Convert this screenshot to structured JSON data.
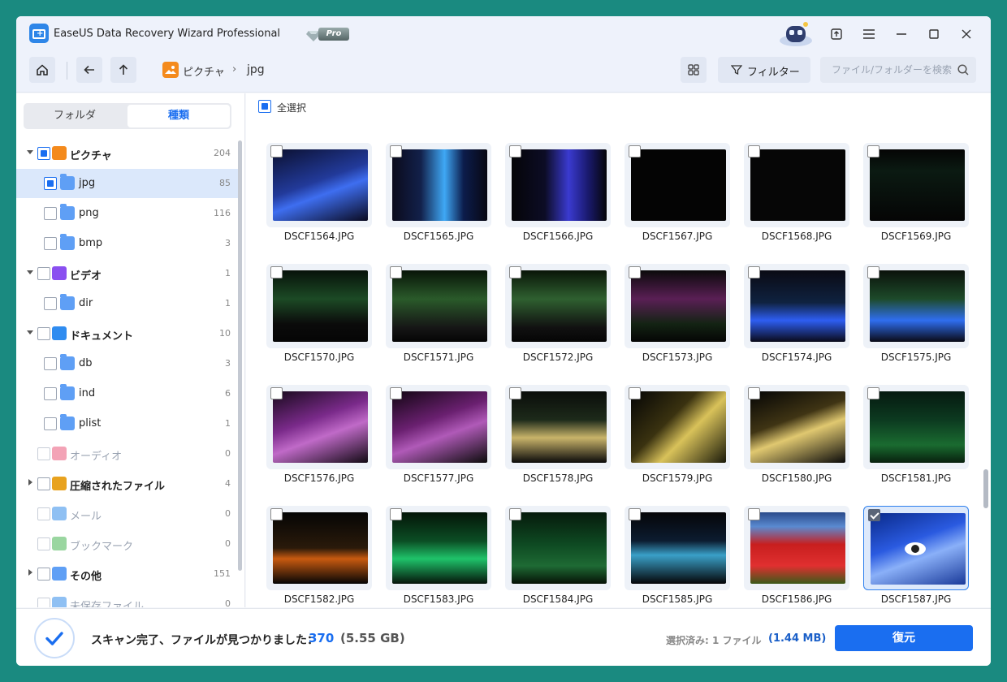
{
  "window": {
    "title": "EaseUS Data Recovery Wizard Professional",
    "pro_badge": "Pro"
  },
  "toolbar": {
    "breadcrumb": [
      "ピクチャ",
      "jpg"
    ],
    "breadcrumb_sep": "›",
    "filter_label": "フィルター",
    "search_placeholder": "ファイル/フォルダーを検索"
  },
  "sidebar": {
    "tabs": [
      "フォルダ",
      "種類"
    ],
    "active_tab": "種類",
    "tree": [
      {
        "label": "ピクチャ",
        "count": "204",
        "level": 1,
        "expanded": true,
        "checked": "partial",
        "icon": "picture-icon",
        "color": "#f48a1c"
      },
      {
        "label": "jpg",
        "count": "85",
        "level": 2,
        "checked": "partial",
        "selected": true,
        "icon": "folder-icon"
      },
      {
        "label": "png",
        "count": "116",
        "level": 2,
        "checked": "none",
        "icon": "folder-icon"
      },
      {
        "label": "bmp",
        "count": "3",
        "level": 2,
        "checked": "none",
        "icon": "folder-icon"
      },
      {
        "label": "ビデオ",
        "count": "1",
        "level": 1,
        "expanded": true,
        "checked": "none",
        "icon": "video-icon",
        "color": "#8a4ff0"
      },
      {
        "label": "dir",
        "count": "1",
        "level": 2,
        "checked": "none",
        "icon": "folder-icon"
      },
      {
        "label": "ドキュメント",
        "count": "10",
        "level": 1,
        "expanded": true,
        "checked": "none",
        "icon": "document-icon",
        "color": "#2f8cf0"
      },
      {
        "label": "db",
        "count": "3",
        "level": 2,
        "checked": "none",
        "icon": "folder-icon"
      },
      {
        "label": "ind",
        "count": "6",
        "level": 2,
        "checked": "none",
        "icon": "folder-icon"
      },
      {
        "label": "plist",
        "count": "1",
        "level": 2,
        "checked": "none",
        "icon": "folder-icon"
      },
      {
        "label": "オーディオ",
        "count": "0",
        "level": 1,
        "checked": "none",
        "disabled": true,
        "icon": "audio-icon",
        "color": "#f3a3b6"
      },
      {
        "label": "圧縮されたファイル",
        "count": "4",
        "level": 1,
        "expanded": false,
        "checked": "none",
        "icon": "archive-icon",
        "color": "#e8a21e"
      },
      {
        "label": "メール",
        "count": "0",
        "level": 1,
        "checked": "none",
        "disabled": true,
        "icon": "mail-icon",
        "color": "#8fc0f3"
      },
      {
        "label": "ブックマーク",
        "count": "0",
        "level": 1,
        "checked": "none",
        "disabled": true,
        "icon": "bookmark-icon",
        "color": "#9ad6a0"
      },
      {
        "label": "その他",
        "count": "151",
        "level": 1,
        "expanded": false,
        "checked": "none",
        "icon": "other-icon",
        "color": "#5f9ff5"
      },
      {
        "label": "未保存ファイル",
        "count": "0",
        "level": 1,
        "checked": "none",
        "disabled": true,
        "icon": "unsaved-icon",
        "color": "#8fc0f3"
      }
    ]
  },
  "main": {
    "select_all_label": "全選択",
    "files": [
      {
        "name": "DSCF1564.JPG",
        "bg": "linear-gradient(160deg,#0b1030 0%,#223a9a 45%,#3e6ef0 60%,#0a0a20 100%)"
      },
      {
        "name": "DSCF1565.JPG",
        "bg": "linear-gradient(90deg,#0b0b1c 0%,#12204a 30%,#3fa8f5 55%,#0c1c4c 75%,#080812 100%)"
      },
      {
        "name": "DSCF1566.JPG",
        "bg": "linear-gradient(90deg,#050508 0%,#0c0c25 35%,#3a3ad0 60%,#1a1a70 80%,#050508 100%)"
      },
      {
        "name": "DSCF1567.JPG",
        "bg": "#040404"
      },
      {
        "name": "DSCF1568.JPG",
        "bg": "#060606"
      },
      {
        "name": "DSCF1569.JPG",
        "bg": "linear-gradient(180deg,#050505 0%,#0b1a12 30%,#050505 100%)"
      },
      {
        "name": "DSCF1570.JPG",
        "bg": "linear-gradient(180deg,#07120a 0%,#1c4a25 40%,#0b0b0b 75%,#050505 100%)"
      },
      {
        "name": "DSCF1571.JPG",
        "bg": "linear-gradient(180deg,#081408 0%,#2a5a2a 40%,#161616 80%,#050505 100%)"
      },
      {
        "name": "DSCF1572.JPG",
        "bg": "linear-gradient(180deg,#091508 0%,#2f6030 40%,#111 80%,#050505 100%)"
      },
      {
        "name": "DSCF1573.JPG",
        "bg": "linear-gradient(180deg,#0b0a0b 0%,#5a1f55 40%,#132313 75%,#050505 100%)"
      },
      {
        "name": "DSCF1574.JPG",
        "bg": "linear-gradient(180deg,#0a0a14 0%,#0f2240 45%,#2e5ef2 70%,#0a0a1a 100%)"
      },
      {
        "name": "DSCF1575.JPG",
        "bg": "linear-gradient(180deg,#0b120b 0%,#1d4a2a 40%,#2f6ef0 70%,#0a0a16 100%)"
      },
      {
        "name": "DSCF1576.JPG",
        "bg": "linear-gradient(160deg,#180a1c 0%,#7a2a8a 40%,#c06ac8 60%,#120a14 100%)"
      },
      {
        "name": "DSCF1577.JPG",
        "bg": "linear-gradient(160deg,#120612 0%,#6a2070 40%,#b05ab8 60%,#0c0c0c 100%)"
      },
      {
        "name": "DSCF1578.JPG",
        "bg": "linear-gradient(180deg,#0a0d0a 0%,#1d2a1a 40%,#c9b46a 65%,#0a0a0a 100%)"
      },
      {
        "name": "DSCF1579.JPG",
        "bg": "linear-gradient(135deg,#050505 0%,#3a3210 40%,#d9c25a 60%,#1a1a0a 100%)"
      },
      {
        "name": "DSCF1580.JPG",
        "bg": "linear-gradient(160deg,#050505 0%,#3f3414 40%,#e0c870 58%,#0a0a0a 100%)"
      },
      {
        "name": "DSCF1581.JPG",
        "bg": "linear-gradient(180deg,#061a10 0%,#0c3a20 40%,#1a6b30 75%,#08200e 100%)"
      },
      {
        "name": "DSCF1582.JPG",
        "bg": "linear-gradient(180deg,#050505 0%,#2a1a0a 50%,#c85a10 65%,#050505 100%)"
      },
      {
        "name": "DSCF1583.JPG",
        "bg": "linear-gradient(180deg,#041508 0%,#0b4d24 40%,#1fc36a 65%,#06140a 100%)"
      },
      {
        "name": "DSCF1584.JPG",
        "bg": "linear-gradient(180deg,#061a0c 0%,#0e4a22 45%,#1e6a34 75%,#061206 100%)"
      },
      {
        "name": "DSCF1585.JPG",
        "bg": "linear-gradient(180deg,#050508 0%,#0c1c30 40%,#3aa0c8 60%,#050508 100%)"
      },
      {
        "name": "DSCF1586.JPG",
        "bg": "linear-gradient(180deg,#2a4a8a 0%,#5a8ad0 20%,#c81e1e 45%,#e03030 75%,#3a5a1a 100%)"
      },
      {
        "name": "DSCF1587.JPG",
        "bg": "linear-gradient(160deg,#0a2a8a 0%,#2a5ae0 40%,#8ab0f8 60%,#1a3a9a 100%)",
        "checked": true,
        "selected": true
      }
    ]
  },
  "status": {
    "scan_text": "スキャン完了、ファイルが見つかりました：",
    "found_count": "370",
    "found_size": "(5.55 GB)",
    "selected_label": "選択済み: 1 ファイル",
    "selected_size": "(1.44 MB)",
    "recover_label": "復元"
  },
  "colors": {
    "accent": "#1a6ef0",
    "background": "#1a8a80"
  }
}
